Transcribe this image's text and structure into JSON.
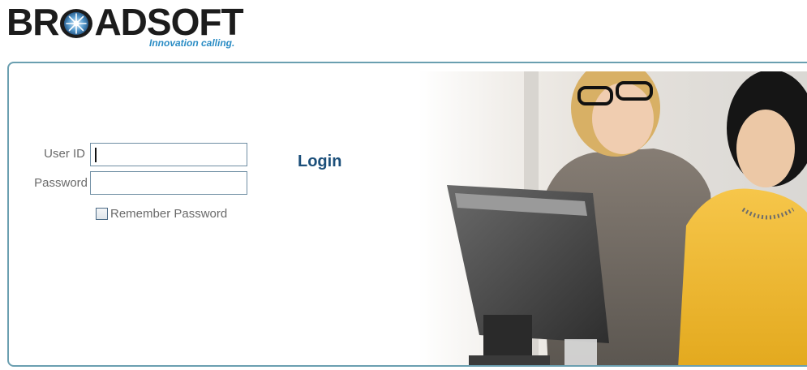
{
  "brand": {
    "name_before_star": "BR",
    "name_after_star": "ADSOFT",
    "tagline": "Innovation calling.",
    "colors": {
      "wordmark": "#1c1c1c",
      "tagline": "#2a8cc4",
      "star": "#5a9ed0"
    }
  },
  "login_form": {
    "userid_label": "User ID",
    "userid_value": "",
    "password_label": "Password",
    "password_value": "",
    "remember_label": "Remember Password",
    "remember_checked": false,
    "login_label": "Login"
  },
  "colors": {
    "panel_border": "#6a9fb0",
    "label_text": "#6a6a6a",
    "login_text": "#1c4f7a",
    "input_border": "#6f8ea3"
  },
  "hero": {
    "icon": "people-at-computer-illustration"
  }
}
